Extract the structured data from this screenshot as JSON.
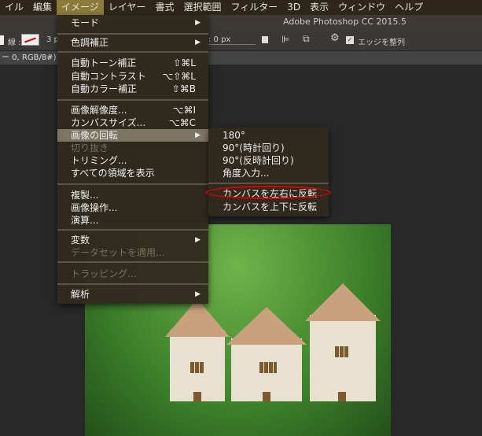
{
  "menubar": [
    "イル",
    "編集",
    "イメージ",
    "レイヤー",
    "書式",
    "選択範囲",
    "フィルター",
    "3D",
    "表示",
    "ウィンドウ",
    "ヘルプ"
  ],
  "window_title": "Adobe Photoshop CC 2015.5",
  "toolbar": {
    "stroke_label": "線 :",
    "stroke_width": "3 p",
    "offset": ": 0 px",
    "align_edges": "エッジを整列"
  },
  "tab": "ー 0, RGB/8#)",
  "menu": [
    {
      "label": "モード",
      "submenu": true
    },
    {
      "label": "色調補正",
      "submenu": true
    },
    {
      "label": "自動トーン補正",
      "shortcut": "⇧⌘L"
    },
    {
      "label": "自動コントラスト",
      "shortcut": "⌥⇧⌘L"
    },
    {
      "label": "自動カラー補正",
      "shortcut": "⇧⌘B"
    },
    {
      "label": "画像解像度...",
      "shortcut": "⌥⌘I"
    },
    {
      "label": "カンバスサイズ...",
      "shortcut": "⌥⌘C"
    },
    {
      "label": "画像の回転",
      "submenu": true
    },
    {
      "label": "切り抜き"
    },
    {
      "label": "トリミング..."
    },
    {
      "label": "すべての領域を表示"
    },
    {
      "label": "複製..."
    },
    {
      "label": "画像操作..."
    },
    {
      "label": "演算..."
    },
    {
      "label": "変数",
      "submenu": true
    },
    {
      "label": "データセットを適用..."
    },
    {
      "label": "トラッピング..."
    },
    {
      "label": "解析",
      "submenu": true
    }
  ],
  "submenu": [
    "180°",
    "90°(時計回り)",
    "90°(反時計回り)",
    "角度入力...",
    "カンバスを左右に反転",
    "カンバスを上下に反転"
  ],
  "arrow": "▶",
  "highlight_color": "#e00000"
}
